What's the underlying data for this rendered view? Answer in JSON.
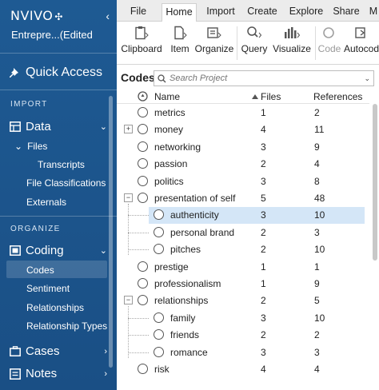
{
  "sidebar": {
    "brand": "NVIVO",
    "brand_mark": "✣",
    "collapse_icon": "‹",
    "project_title": "Entrepre...(Edited",
    "quick_access": "Quick Access",
    "import_heading": "IMPORT",
    "data": {
      "label": "Data",
      "chevron": "⌄"
    },
    "files": {
      "label": "Files",
      "chevron": "⌄"
    },
    "transcripts": "Transcripts",
    "file_classifications": "File Classifications",
    "externals": "Externals",
    "organize_heading": "ORGANIZE",
    "coding": {
      "label": "Coding",
      "chevron": "⌄"
    },
    "coding_items": [
      "Codes",
      "Sentiment",
      "Relationships",
      "Relationship Types"
    ],
    "cases": {
      "label": "Cases",
      "chevron": "›"
    },
    "notes": {
      "label": "Notes",
      "chevron": "›"
    }
  },
  "ribbon": {
    "tabs": [
      "File",
      "Home",
      "Import",
      "Create",
      "Explore",
      "Share",
      "M"
    ],
    "active_tab": "Home",
    "buttons": [
      {
        "label": "Clipboard",
        "icon": "clipboard-icon",
        "enabled": true
      },
      {
        "label": "Item",
        "icon": "item-icon",
        "enabled": true
      },
      {
        "label": "Organize",
        "icon": "organize-icon",
        "enabled": true
      },
      {
        "label": "Query",
        "icon": "query-icon",
        "enabled": true
      },
      {
        "label": "Visualize",
        "icon": "visualize-icon",
        "enabled": true
      },
      {
        "label": "Code",
        "icon": "code-icon",
        "enabled": false
      },
      {
        "label": "Autocod",
        "icon": "autocode-icon",
        "enabled": true
      }
    ]
  },
  "codes_panel": {
    "title": "Codes",
    "search_placeholder": "Search Project",
    "columns": {
      "name": "Name",
      "files": "Files",
      "references": "References"
    },
    "rows": [
      {
        "name": "metrics",
        "files": "1",
        "refs": "2",
        "level": 0,
        "expander": ""
      },
      {
        "name": "money",
        "files": "4",
        "refs": "11",
        "level": 0,
        "expander": "+"
      },
      {
        "name": "networking",
        "files": "3",
        "refs": "9",
        "level": 0,
        "expander": ""
      },
      {
        "name": "passion",
        "files": "2",
        "refs": "4",
        "level": 0,
        "expander": ""
      },
      {
        "name": "politics",
        "files": "3",
        "refs": "8",
        "level": 0,
        "expander": ""
      },
      {
        "name": "presentation of self",
        "files": "5",
        "refs": "48",
        "level": 0,
        "expander": "−"
      },
      {
        "name": "authenticity",
        "files": "3",
        "refs": "10",
        "level": 1,
        "expander": "",
        "selected": true
      },
      {
        "name": "personal brand",
        "files": "2",
        "refs": "3",
        "level": 1,
        "expander": ""
      },
      {
        "name": "pitches",
        "files": "2",
        "refs": "10",
        "level": 1,
        "expander": ""
      },
      {
        "name": "prestige",
        "files": "1",
        "refs": "1",
        "level": 0,
        "expander": ""
      },
      {
        "name": "professionalism",
        "files": "1",
        "refs": "9",
        "level": 0,
        "expander": ""
      },
      {
        "name": "relationships",
        "files": "2",
        "refs": "5",
        "level": 0,
        "expander": "−"
      },
      {
        "name": "family",
        "files": "3",
        "refs": "10",
        "level": 1,
        "expander": ""
      },
      {
        "name": "friends",
        "files": "2",
        "refs": "2",
        "level": 1,
        "expander": ""
      },
      {
        "name": "romance",
        "files": "3",
        "refs": "3",
        "level": 1,
        "expander": ""
      },
      {
        "name": "risk",
        "files": "4",
        "refs": "4",
        "level": 0,
        "expander": ""
      }
    ]
  }
}
